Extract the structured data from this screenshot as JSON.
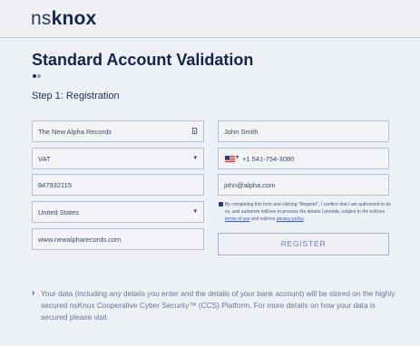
{
  "brand": {
    "prefix": "ns",
    "name": "knox"
  },
  "page": {
    "title": "Standard Account Validation",
    "step_label": "Step 1: Registration"
  },
  "form": {
    "company_name": "The New Alpha Records",
    "id_type": "VAT",
    "id_number": "847932115",
    "country": "United States",
    "website": "www.newalpharecords.com",
    "contact_name": "John Smith",
    "phone": "+1 541-754-3080",
    "email": "john@alpha.com"
  },
  "consent": {
    "text_before": "By completing this form and clicking \"Register\", I confirm that I am authorized to do so, and authorize nsKnox to process the details I provide, subject to the nsKnox ",
    "terms_link": "terms of use",
    "text_middle": " and nsKnox ",
    "privacy_link": "privacy policy",
    "text_after": "."
  },
  "register_button": "REGISTER",
  "info_text": "Your data (including any details you enter and the details of your bank account) will be stored on the highly secured nsKnox Cooperative Cyber Security™ (CCS) Platform. For more details on how your data is secured please visit",
  "icons": {
    "chevron": "›",
    "dropdown": "▾"
  },
  "colors": {
    "brand_navy": "#16244a",
    "accent_blue": "#2f56c9",
    "background": "#edf0f5"
  }
}
